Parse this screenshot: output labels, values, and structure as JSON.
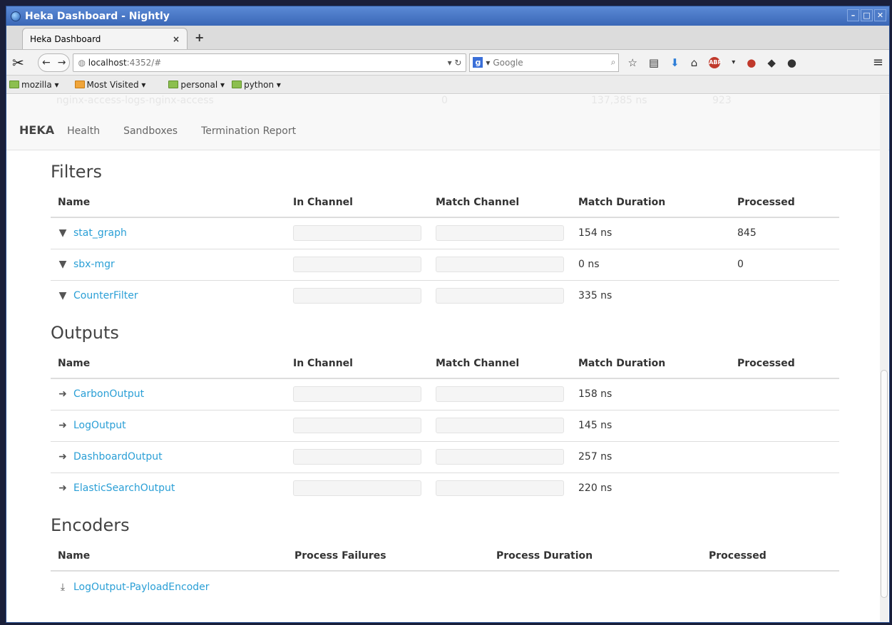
{
  "window": {
    "title": "Heka Dashboard - Nightly"
  },
  "tab": {
    "label": "Heka Dashboard",
    "close": "×",
    "new_tab": "+"
  },
  "nav": {
    "url_host": "localhost",
    "url_rest": ":4352/#",
    "search_placeholder": "Google"
  },
  "bookmarks": [
    {
      "label": "mozilla ▾"
    },
    {
      "label": "Most Visited ▾"
    },
    {
      "label": "personal ▾"
    },
    {
      "label": "python ▾"
    }
  ],
  "appnav": {
    "brand": "HEKA",
    "links": [
      "Health",
      "Sandboxes",
      "Termination Report"
    ],
    "ghost_text": {
      "name": "nginx-access-logs-nginx-access",
      "value1": "0",
      "value2": "137,385 ns",
      "value3": "923"
    }
  },
  "filters": {
    "title": "Filters",
    "headers": [
      "Name",
      "In Channel",
      "Match Channel",
      "Match Duration",
      "Processed"
    ],
    "rows": [
      {
        "name": "stat_graph",
        "duration": "154 ns",
        "processed": "845"
      },
      {
        "name": "sbx-mgr",
        "duration": "0 ns",
        "processed": "0"
      },
      {
        "name": "CounterFilter",
        "duration": "335 ns",
        "processed": ""
      }
    ]
  },
  "outputs": {
    "title": "Outputs",
    "headers": [
      "Name",
      "In Channel",
      "Match Channel",
      "Match Duration",
      "Processed"
    ],
    "rows": [
      {
        "name": "CarbonOutput",
        "duration": "158 ns",
        "processed": ""
      },
      {
        "name": "LogOutput",
        "duration": "145 ns",
        "processed": ""
      },
      {
        "name": "DashboardOutput",
        "duration": "257 ns",
        "processed": ""
      },
      {
        "name": "ElasticSearchOutput",
        "duration": "220 ns",
        "processed": ""
      }
    ]
  },
  "encoders": {
    "title": "Encoders",
    "headers": [
      "Name",
      "Process Failures",
      "Process Duration",
      "Processed"
    ],
    "rows": [
      {
        "name": "LogOutput-PayloadEncoder"
      }
    ]
  },
  "icons": {
    "filter": "filter-icon",
    "output": "sign-out-icon",
    "encoder": "download-icon"
  }
}
